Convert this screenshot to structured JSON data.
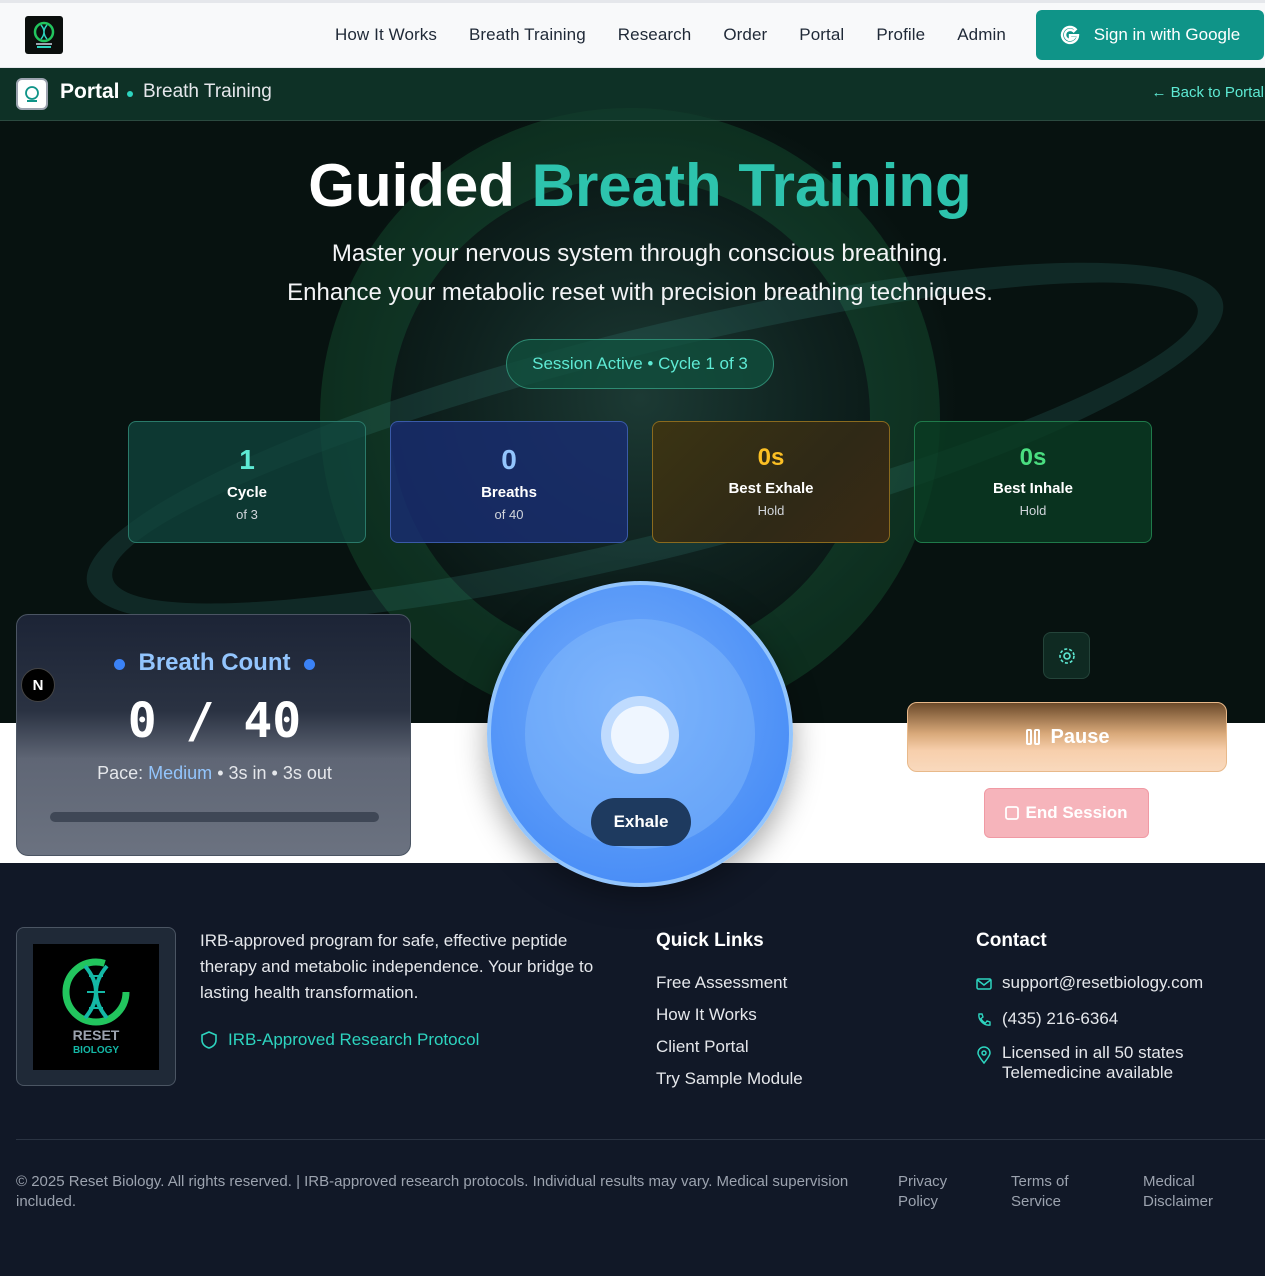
{
  "nav": {
    "items": [
      "How It Works",
      "Breath Training",
      "Research",
      "Order",
      "Portal",
      "Profile",
      "Admin"
    ],
    "signin": "Sign in with Google"
  },
  "subheader": {
    "portal": "Portal",
    "page": "Breath Training",
    "back": "← Back to Portal"
  },
  "hero": {
    "title_a": "Guided",
    "title_b": "Breath Training",
    "line1": "Master your nervous system through conscious breathing.",
    "line2": "Enhance your metabolic reset with precision breathing techniques.",
    "session": "Session Active • Cycle 1 of 3"
  },
  "stats": [
    {
      "value": "1",
      "label": "Cycle",
      "sub": "of 3"
    },
    {
      "value": "0",
      "label": "Breaths",
      "sub": "of 40"
    },
    {
      "value": "0s",
      "label": "Best Exhale",
      "sub": "Hold"
    },
    {
      "value": "0s",
      "label": "Best Inhale",
      "sub": "Hold"
    }
  ],
  "breath": {
    "title": "Breath Count",
    "count": "0 / 40",
    "pace_label": "Pace:",
    "pace_value": "Medium",
    "in": "3s in",
    "out": "3s out",
    "progress": 0,
    "phase": "Exhale",
    "badge": "N"
  },
  "controls": {
    "pause": "Pause",
    "end": "End Session"
  },
  "footer": {
    "logo_text_1": "RESET",
    "logo_text_2": "BIOLOGY",
    "description": "IRB-approved program for safe, effective peptide therapy and metabolic independence. Your bridge to lasting health transformation.",
    "irb": "IRB-Approved Research Protocol",
    "quick_title": "Quick Links",
    "quick_links": [
      "Free Assessment",
      "How It Works",
      "Client Portal",
      "Try Sample Module"
    ],
    "contact_title": "Contact",
    "email": "support@resetbiology.com",
    "phone": "(435) 216-6364",
    "licensed": "Licensed in all 50 states",
    "tele": "Telemedicine available",
    "copyright": "© 2025 Reset Biology. All rights reserved. | IRB-approved research protocols. Individual results may vary. Medical supervision included.",
    "legal": [
      "Privacy Policy",
      "Terms of Service",
      "Medical Disclaimer"
    ]
  }
}
